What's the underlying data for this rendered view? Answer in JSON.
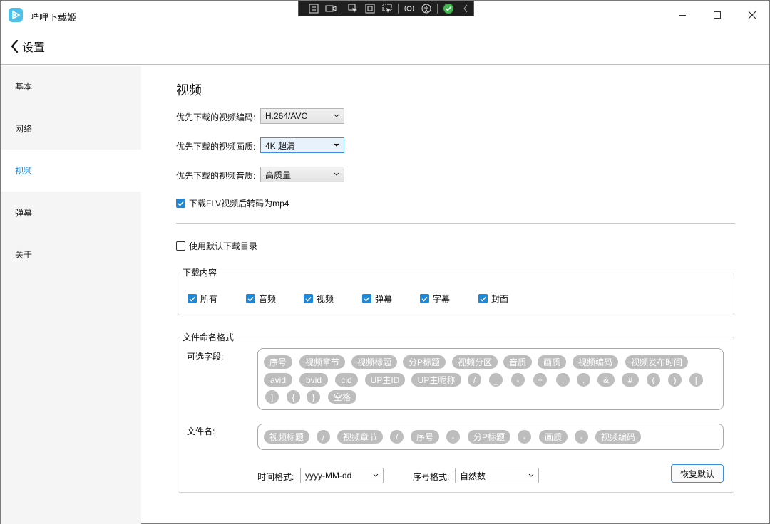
{
  "app": {
    "title": "哔哩下载姬"
  },
  "header": {
    "back_label": "设置"
  },
  "sidebar": {
    "items": [
      {
        "label": "基本"
      },
      {
        "label": "网络"
      },
      {
        "label": "视频"
      },
      {
        "label": "弹幕"
      },
      {
        "label": "关于"
      }
    ],
    "active": "视频"
  },
  "main": {
    "section_title": "视频",
    "codec": {
      "label": "优先下载的视频编码:",
      "value": "H.264/AVC"
    },
    "quality": {
      "label": "优先下载的视频画质:",
      "value": "4K 超清"
    },
    "audio": {
      "label": "优先下载的视频音质:",
      "value": "高质量"
    },
    "transcode": {
      "label": "下载FLV视频后转码为mp4",
      "checked": true
    },
    "default_dir": {
      "label": "使用默认下载目录",
      "checked": false
    },
    "download_content": {
      "legend": "下载内容",
      "items": [
        {
          "label": "所有",
          "checked": true
        },
        {
          "label": "音频",
          "checked": true
        },
        {
          "label": "视频",
          "checked": true
        },
        {
          "label": "弹幕",
          "checked": true
        },
        {
          "label": "字幕",
          "checked": true
        },
        {
          "label": "封面",
          "checked": true
        }
      ]
    },
    "file_naming": {
      "legend": "文件命名格式",
      "optional_label": "可选字段:",
      "optional_fields": [
        "序号",
        "视频章节",
        "视频标题",
        "分P标题",
        "视频分区",
        "音质",
        "画质",
        "视频编码",
        "视频发布时间",
        "avid",
        "bvid",
        "cid",
        "UP主ID",
        "UP主昵称",
        "/",
        "_",
        "-",
        "+",
        ",",
        ".",
        "&",
        "#",
        "(",
        ")",
        "[",
        "]",
        "{",
        "}",
        "空格"
      ],
      "filename_label": "文件名:",
      "filename_fields": [
        "视频标题",
        "/",
        "视频章节",
        "/",
        "序号",
        "-",
        "分P标题",
        "-",
        "画质",
        "-",
        "视频编码"
      ],
      "time_format_label": "时间格式:",
      "time_format": "yyyy-MM-dd",
      "index_format_label": "序号格式:",
      "index_format": "自然数",
      "restore_label": "恢复默认"
    }
  },
  "colors": {
    "accent": "#1e88d6",
    "chip": "#bdbdbd",
    "sidebar_bg": "#f5f5f5"
  }
}
